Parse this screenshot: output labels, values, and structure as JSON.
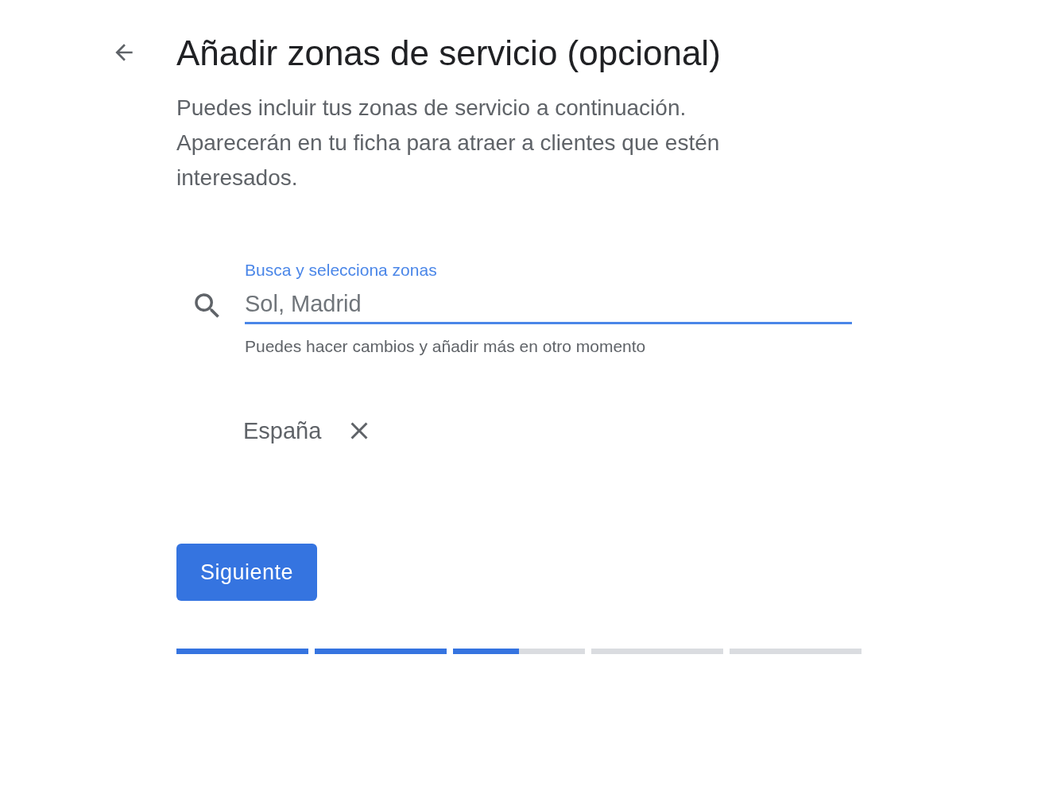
{
  "title": "Añadir zonas de servicio (opcional)",
  "description": "Puedes incluir tus zonas de servicio a continuación. Aparecerán en tu ficha para atraer a clientes que estén interesados.",
  "search": {
    "label": "Busca y selecciona zonas",
    "placeholder": "Sol, Madrid",
    "helper": "Puedes hacer cambios y añadir más en otro momento"
  },
  "areas": [
    {
      "label": "España"
    }
  ],
  "button": "Siguiente",
  "progress": {
    "level": 0.5
  }
}
